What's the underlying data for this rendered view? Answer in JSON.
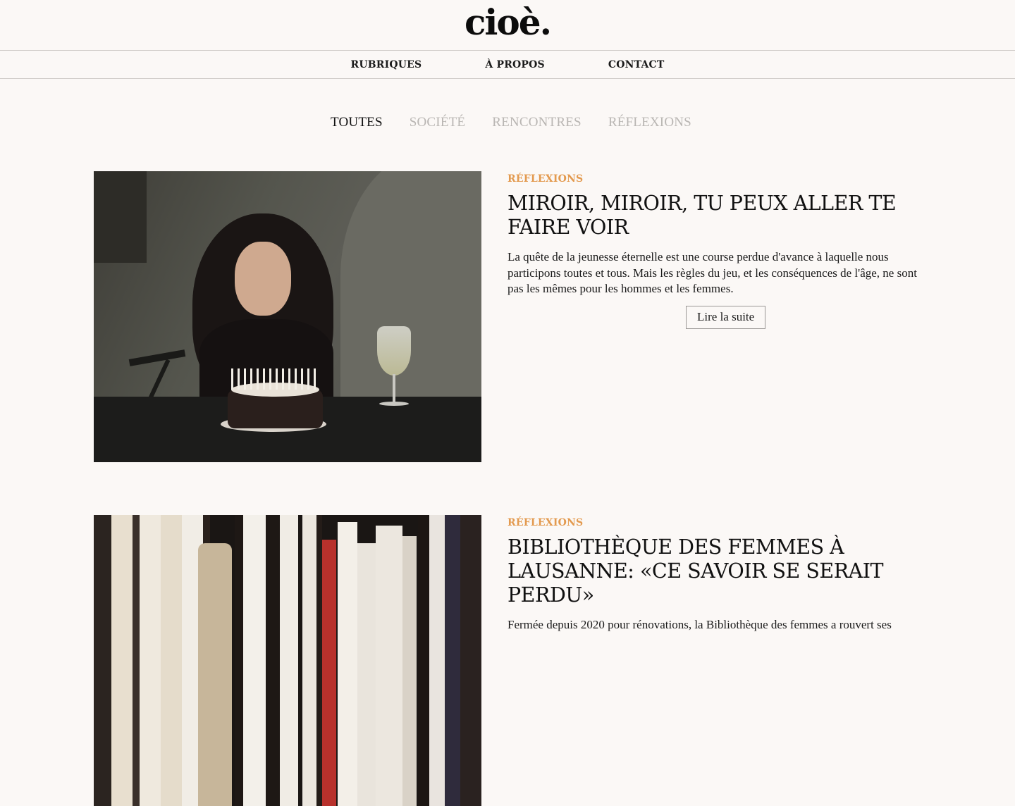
{
  "site": {
    "logo": "cioè."
  },
  "nav": [
    {
      "label": "RUBRIQUES"
    },
    {
      "label": "À PROPOS"
    },
    {
      "label": "CONTACT"
    }
  ],
  "filters": [
    {
      "label": "TOUTES",
      "active": true
    },
    {
      "label": "SOCIÉTÉ",
      "active": false
    },
    {
      "label": "RENCONTRES",
      "active": false
    },
    {
      "label": "RÉFLEXIONS",
      "active": false
    }
  ],
  "articles": [
    {
      "category": "RÉFLEXIONS",
      "title": "MIROIR, MIROIR, TU PEUX ALLER TE FAIRE VOIR",
      "excerpt": "La quête de la jeunesse éternelle est une course perdue d'avance à laquelle nous participons toutes et tous. Mais les règles du jeu, et les conséquences de l'âge, ne sont pas les mêmes pour les hommes et les femmes.",
      "read_more": "Lire la suite"
    },
    {
      "category": "RÉFLEXIONS",
      "title": "BIBLIOTHÈQUE DES FEMMES À LAUSANNE: «CE SAVOIR SE SERAIT PERDU»",
      "excerpt": "Fermée depuis 2020 pour rénovations, la Bibliothèque des femmes a rouvert ses"
    }
  ],
  "colors": {
    "accent": "#e39a4f",
    "background": "#fbf8f6",
    "muted": "#b9b6b3"
  }
}
